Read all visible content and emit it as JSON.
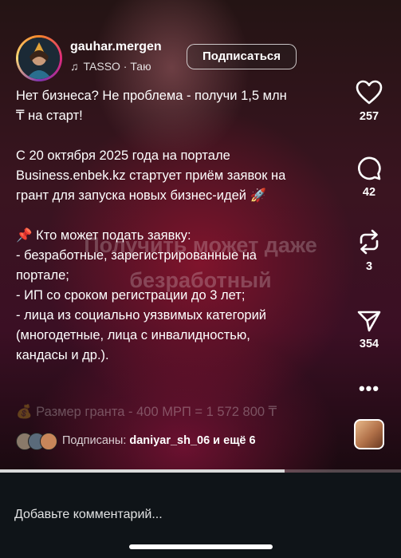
{
  "post": {
    "username": "gauhar.mergen",
    "music_label": "TASSO · Таю",
    "follow_label": "Подписаться",
    "caption": "Нет бизнеса? Не проблема - получи 1,5 млн\n₸ на старт!\n\nС 20 октября 2025 года на портале\nBusiness.enbek.kz стартует приём заявок на\nгрант для запуска новых бизнес-идей 🚀\n\n📌 Кто может подать заявку:\n- безработные, зарегистрированные на\nпортале;\n- ИП со сроком регистрации до 3 лет;\n- лица из социально уязвимых категорий\n(многодетные, лица с инвалидностью,\nкандасы и др.).",
    "caption_faded": "💰 Размер гранта - 400 МРП = 1 572 800 ₸",
    "overlay_text_1": "Получить может даже",
    "overlay_text_2": "безработный"
  },
  "actions": {
    "likes": "257",
    "comments": "42",
    "reposts": "3",
    "shares": "354",
    "more_label": "•••"
  },
  "followers": {
    "prefix": "Подписаны: ",
    "name": "daniyar_sh_06",
    "suffix": " и ещё 6"
  },
  "comment_placeholder": "Добавьте комментарий...",
  "video_progress": 0.71,
  "icons": [
    "heart-icon",
    "comment-icon",
    "repost-icon",
    "send-icon",
    "more-icon",
    "music-note-icon"
  ]
}
